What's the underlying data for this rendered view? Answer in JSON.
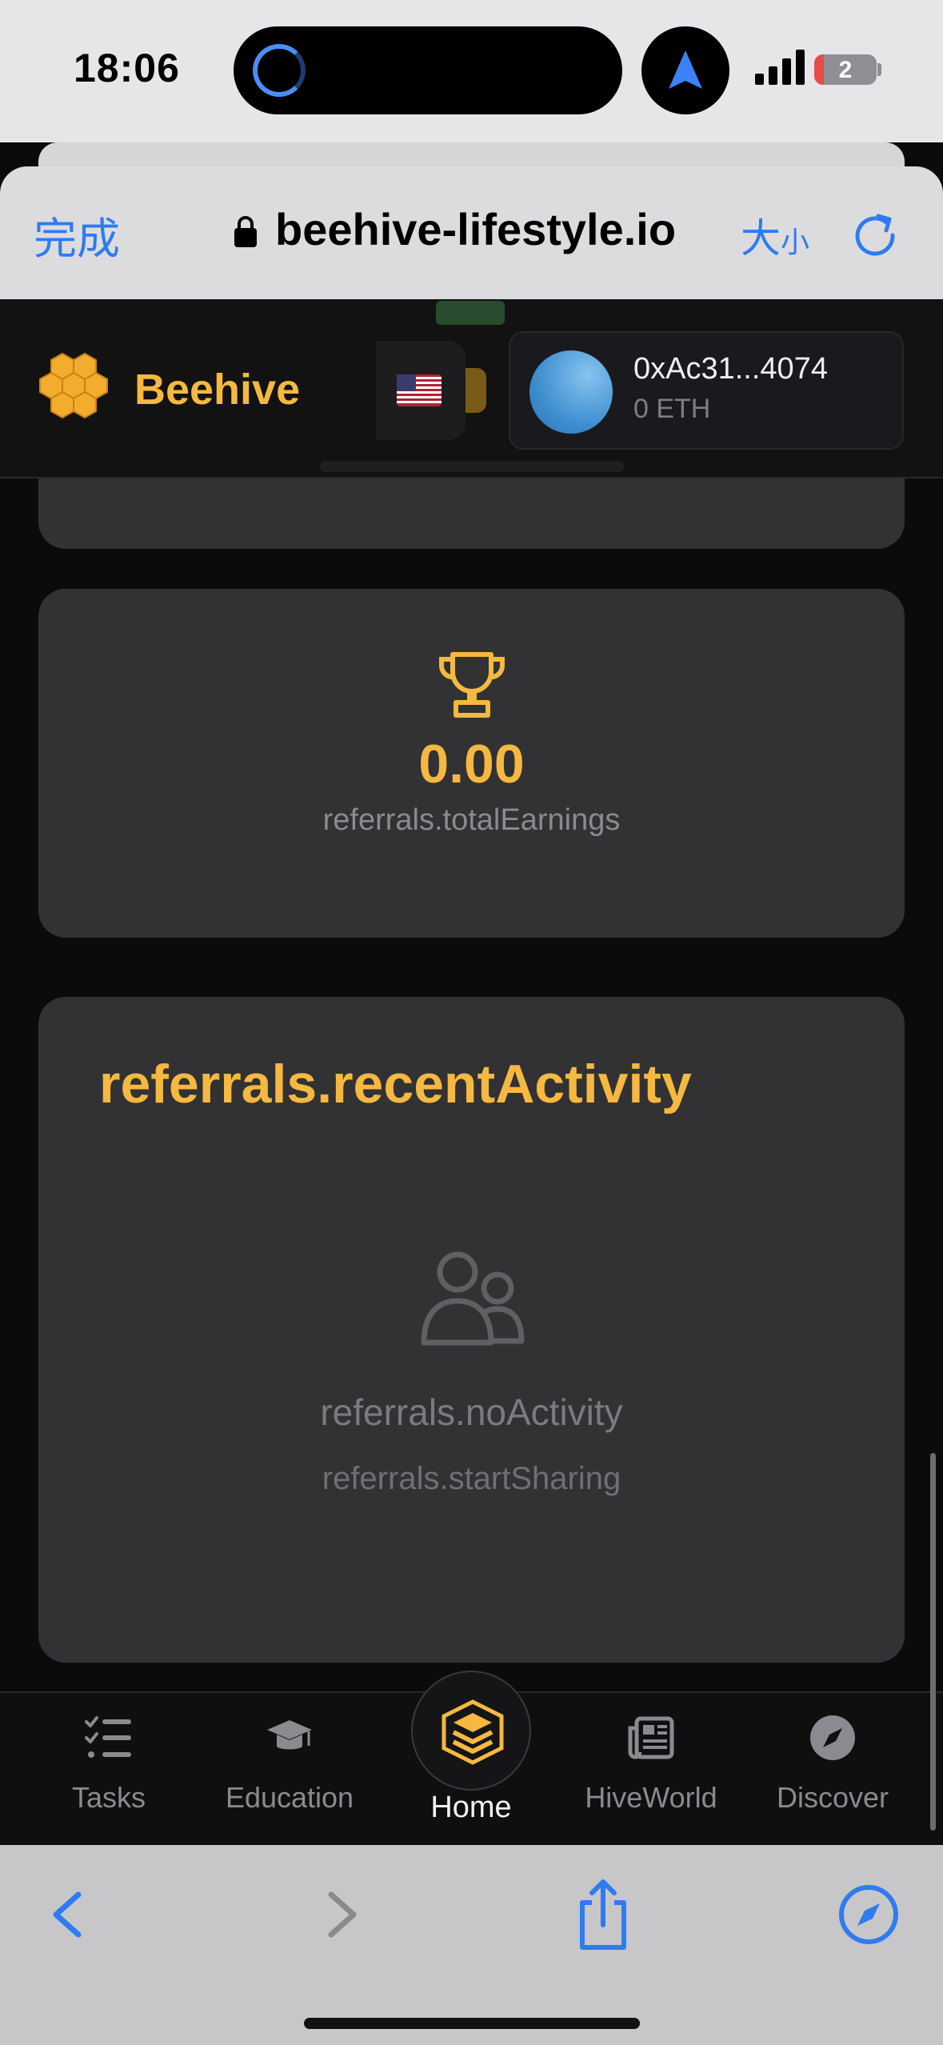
{
  "status_bar": {
    "time": "18:06",
    "battery_level": "2",
    "icons": [
      "activity-ring-icon",
      "navigation-arrow-icon",
      "cellular-signal-icon",
      "battery-icon"
    ]
  },
  "browser": {
    "done_label": "完成",
    "url": "beehive-lifestyle.io",
    "text_size_label_large": "大",
    "text_size_label_small": "小",
    "icons": [
      "lock-icon",
      "reload-icon"
    ]
  },
  "header": {
    "brand": "Beehive",
    "language_flag": "us-flag-icon",
    "wallet_address": "0xAc31...4074",
    "wallet_balance": "0 ETH"
  },
  "earnings_card": {
    "icon": "trophy-icon",
    "value": "0.00",
    "label": "referrals.totalEarnings"
  },
  "activity_card": {
    "title": "referrals.recentActivity",
    "icon": "users-icon",
    "empty_title": "referrals.noActivity",
    "empty_subtitle": "referrals.startSharing"
  },
  "bottom_nav": {
    "items": [
      {
        "label": "Tasks",
        "icon": "checklist-icon"
      },
      {
        "label": "Education",
        "icon": "graduation-cap-icon"
      },
      {
        "label": "Home",
        "icon": "hive-layers-icon",
        "active": true
      },
      {
        "label": "HiveWorld",
        "icon": "newspaper-icon"
      },
      {
        "label": "Discover",
        "icon": "compass-icon"
      }
    ]
  },
  "safari_toolbar": {
    "buttons": [
      "back-icon",
      "forward-icon",
      "share-icon",
      "compass-icon"
    ]
  },
  "colors": {
    "accent": "#f5b840",
    "link_blue": "#2f7bf0",
    "card_bg": "#323234",
    "page_bg": "#0b0b0c"
  }
}
